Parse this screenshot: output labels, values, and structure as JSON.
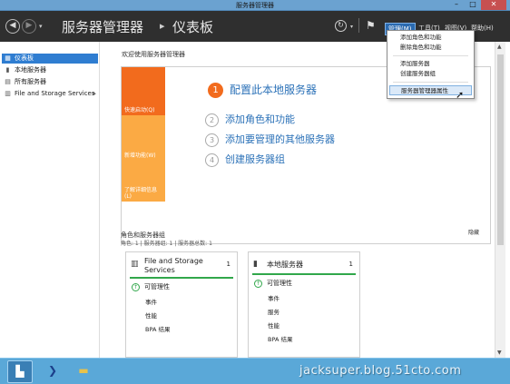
{
  "window": {
    "title": "服务器管理器",
    "minimize": "–",
    "maximize": "□",
    "close": "✕"
  },
  "header": {
    "breadcrumb_root": "服务器管理器",
    "breadcrumb_separator": "▸",
    "breadcrumb_current": "仪表板",
    "menus": {
      "manage": "管理(M)",
      "tools": "工具(T)",
      "view": "视图(V)",
      "help": "帮助(H)"
    }
  },
  "sidebar": {
    "items": [
      {
        "label": "仪表板",
        "icon": "dashboard-icon",
        "active": true
      },
      {
        "label": "本地服务器",
        "icon": "server-icon"
      },
      {
        "label": "所有服务器",
        "icon": "servers-icon"
      },
      {
        "label": "File and Storage Services",
        "icon": "storage-icon",
        "has_arrow": true
      }
    ]
  },
  "main": {
    "welcome": "欢迎使用服务器管理器",
    "quick_start": {
      "left_blocks": [
        "快速启动(Q)",
        "新增功能(W)",
        "了解详细信息(L)"
      ],
      "steps": [
        {
          "num": "1",
          "label": "配置此本地服务器"
        },
        {
          "num": "2",
          "label": "添加角色和功能"
        },
        {
          "num": "3",
          "label": "添加要管理的其他服务器"
        },
        {
          "num": "4",
          "label": "创建服务器组"
        }
      ],
      "hide": "隐藏"
    },
    "roles": {
      "title": "角色和服务器组",
      "summary": "角色: 1 | 服务器组: 1 | 服务器总数: 1"
    },
    "tiles": [
      {
        "name": "File and Storage Services",
        "count": "1",
        "status": "可管理性",
        "rows": [
          "事件",
          "性能",
          "BPA 结果"
        ]
      },
      {
        "name": "本地服务器",
        "count": "1",
        "status": "可管理性",
        "rows": [
          "事件",
          "服务",
          "性能",
          "BPA 结果"
        ]
      }
    ]
  },
  "dropdown": {
    "items": [
      "添加角色和功能",
      "删除角色和功能",
      "添加服务器",
      "创建服务器组",
      "服务器管理器属性"
    ],
    "highlighted_index": 4
  },
  "watermark": "jacksuper.blog.51cto.com",
  "colors": {
    "accent_orange": "#f26b1d",
    "light_orange": "#fbaa44",
    "header_dark": "#2f2f2f",
    "sidebar_active": "#2f7dd1",
    "healthy_green": "#31a74b",
    "taskbar": "#5aa8d8"
  }
}
